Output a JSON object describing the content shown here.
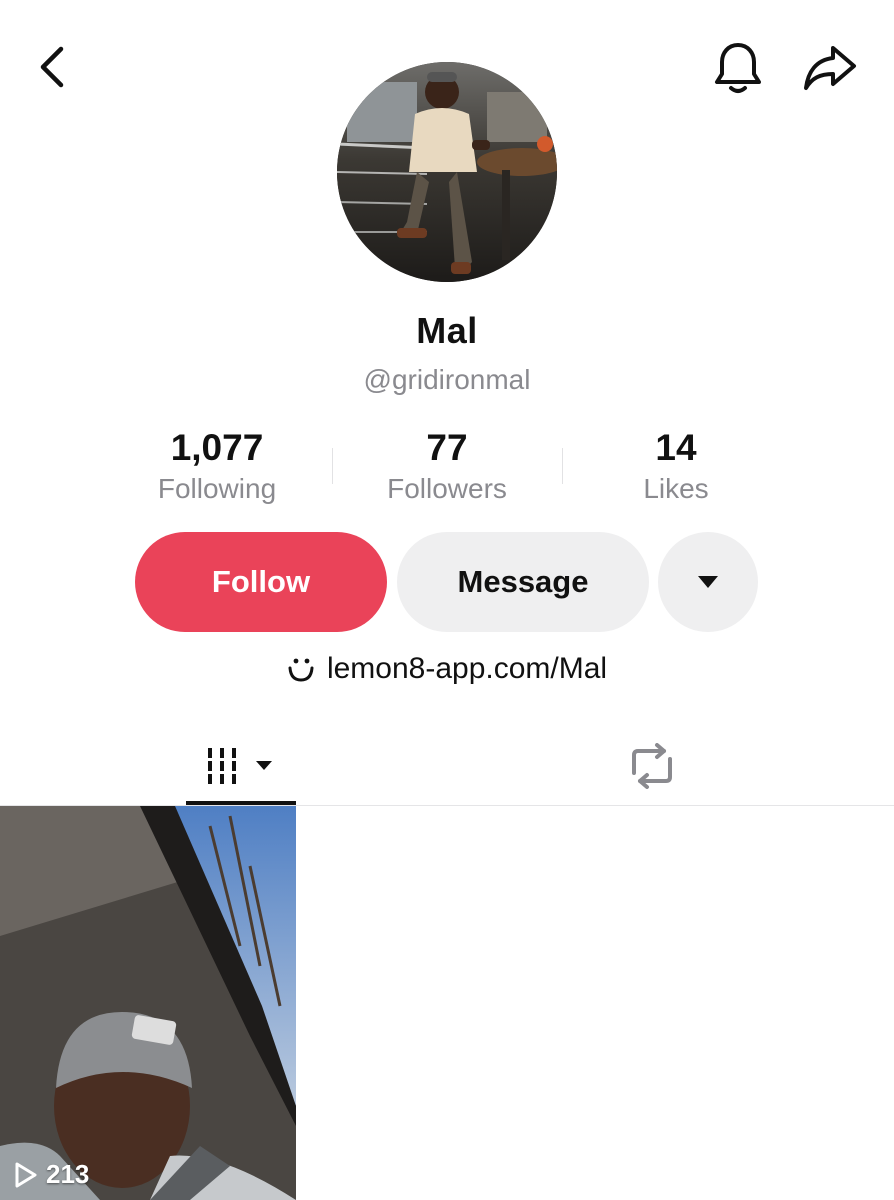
{
  "header": {
    "back_icon": "chevron-left-icon",
    "notification_icon": "bell-icon",
    "share_icon": "share-arrow-icon"
  },
  "profile": {
    "display_name": "Mal",
    "username": "@gridironmal"
  },
  "stats": {
    "following": {
      "value": "1,077",
      "label": "Following"
    },
    "followers": {
      "value": "77",
      "label": "Followers"
    },
    "likes": {
      "value": "14",
      "label": "Likes"
    }
  },
  "actions": {
    "follow_label": "Follow",
    "message_label": "Message",
    "more_icon": "caret-down-icon"
  },
  "bio": {
    "link_icon": "smile-icon",
    "link_text": "lemon8-app.com/Mal"
  },
  "tabs": {
    "videos_icon": "grid-icon",
    "reposts_icon": "repost-icon"
  },
  "videos": [
    {
      "views": "213",
      "play_icon": "play-icon"
    }
  ],
  "colors": {
    "follow_button": "#ea4359",
    "secondary_button": "#efeff0",
    "muted_text": "#8a8a8f",
    "primary_text": "#111111"
  }
}
